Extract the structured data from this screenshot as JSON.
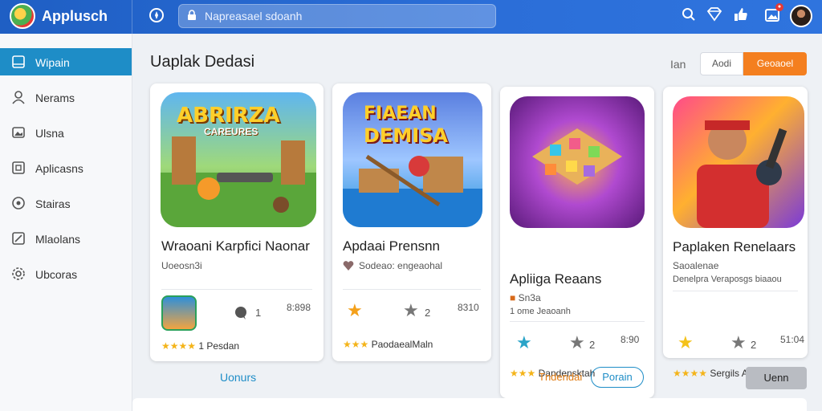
{
  "app": {
    "title": "Applusch"
  },
  "search": {
    "placeholder": "Napreasael sdoanh"
  },
  "sidebar": {
    "items": [
      {
        "label": "Wipain",
        "icon": "tablet-icon",
        "active": true
      },
      {
        "label": "Nerams",
        "icon": "user-icon",
        "active": false
      },
      {
        "label": "Ulsna",
        "icon": "image-icon",
        "active": false
      },
      {
        "label": "Aplicasns",
        "icon": "apps-icon",
        "active": false
      },
      {
        "label": "Stairas",
        "icon": "circle-icon",
        "active": false
      },
      {
        "label": "Mlaolans",
        "icon": "pen-icon",
        "active": false
      },
      {
        "label": "Ubcoras",
        "icon": "gear-icon",
        "active": false
      }
    ]
  },
  "main": {
    "title": "Uaplak Dedasi",
    "sort_label": "Ian",
    "secondary_button": "Aodi",
    "primary_button": "Geoaoel",
    "load_link": "Uonurs",
    "more_button": "Uenn"
  },
  "cards": [
    {
      "name": "Wraoani Karpfici Naonar",
      "sub": "Uoeosn3i",
      "icon_rating": "1",
      "count": "8:898",
      "stars_label": "1 Pesdan",
      "art_text": "ABRIRZA",
      "art_sub": "CAREURES"
    },
    {
      "name": "Apdaai Prensnn",
      "sub": "Sodeao: engeaohal",
      "icon_rating": "2",
      "count": "8310",
      "stars_label": "PaodaealMaln",
      "art_text": "FIAEAN",
      "art_sub": "DEMISA"
    },
    {
      "name": "Apliiga Reaans",
      "sub": "Sn3a",
      "sub2": "1 ome Jeaoanh",
      "icon_rating": "2",
      "count": "8:90",
      "stars_label": "Dandensktah",
      "footer_label": "Tndendai",
      "footer_button": "Porain"
    },
    {
      "name": "Paplaken Renelaars",
      "sub": "Saoalenae",
      "sub2": "Denelpra Veraposgs biaaou",
      "icon_rating": "2",
      "count": "51:04",
      "stars_label": "Sergils Akea"
    }
  ],
  "colors": {
    "accent": "#1e8dc7",
    "primary": "#f47f1f",
    "topbar": "#2b6ed8",
    "star": "#f4b41a"
  }
}
